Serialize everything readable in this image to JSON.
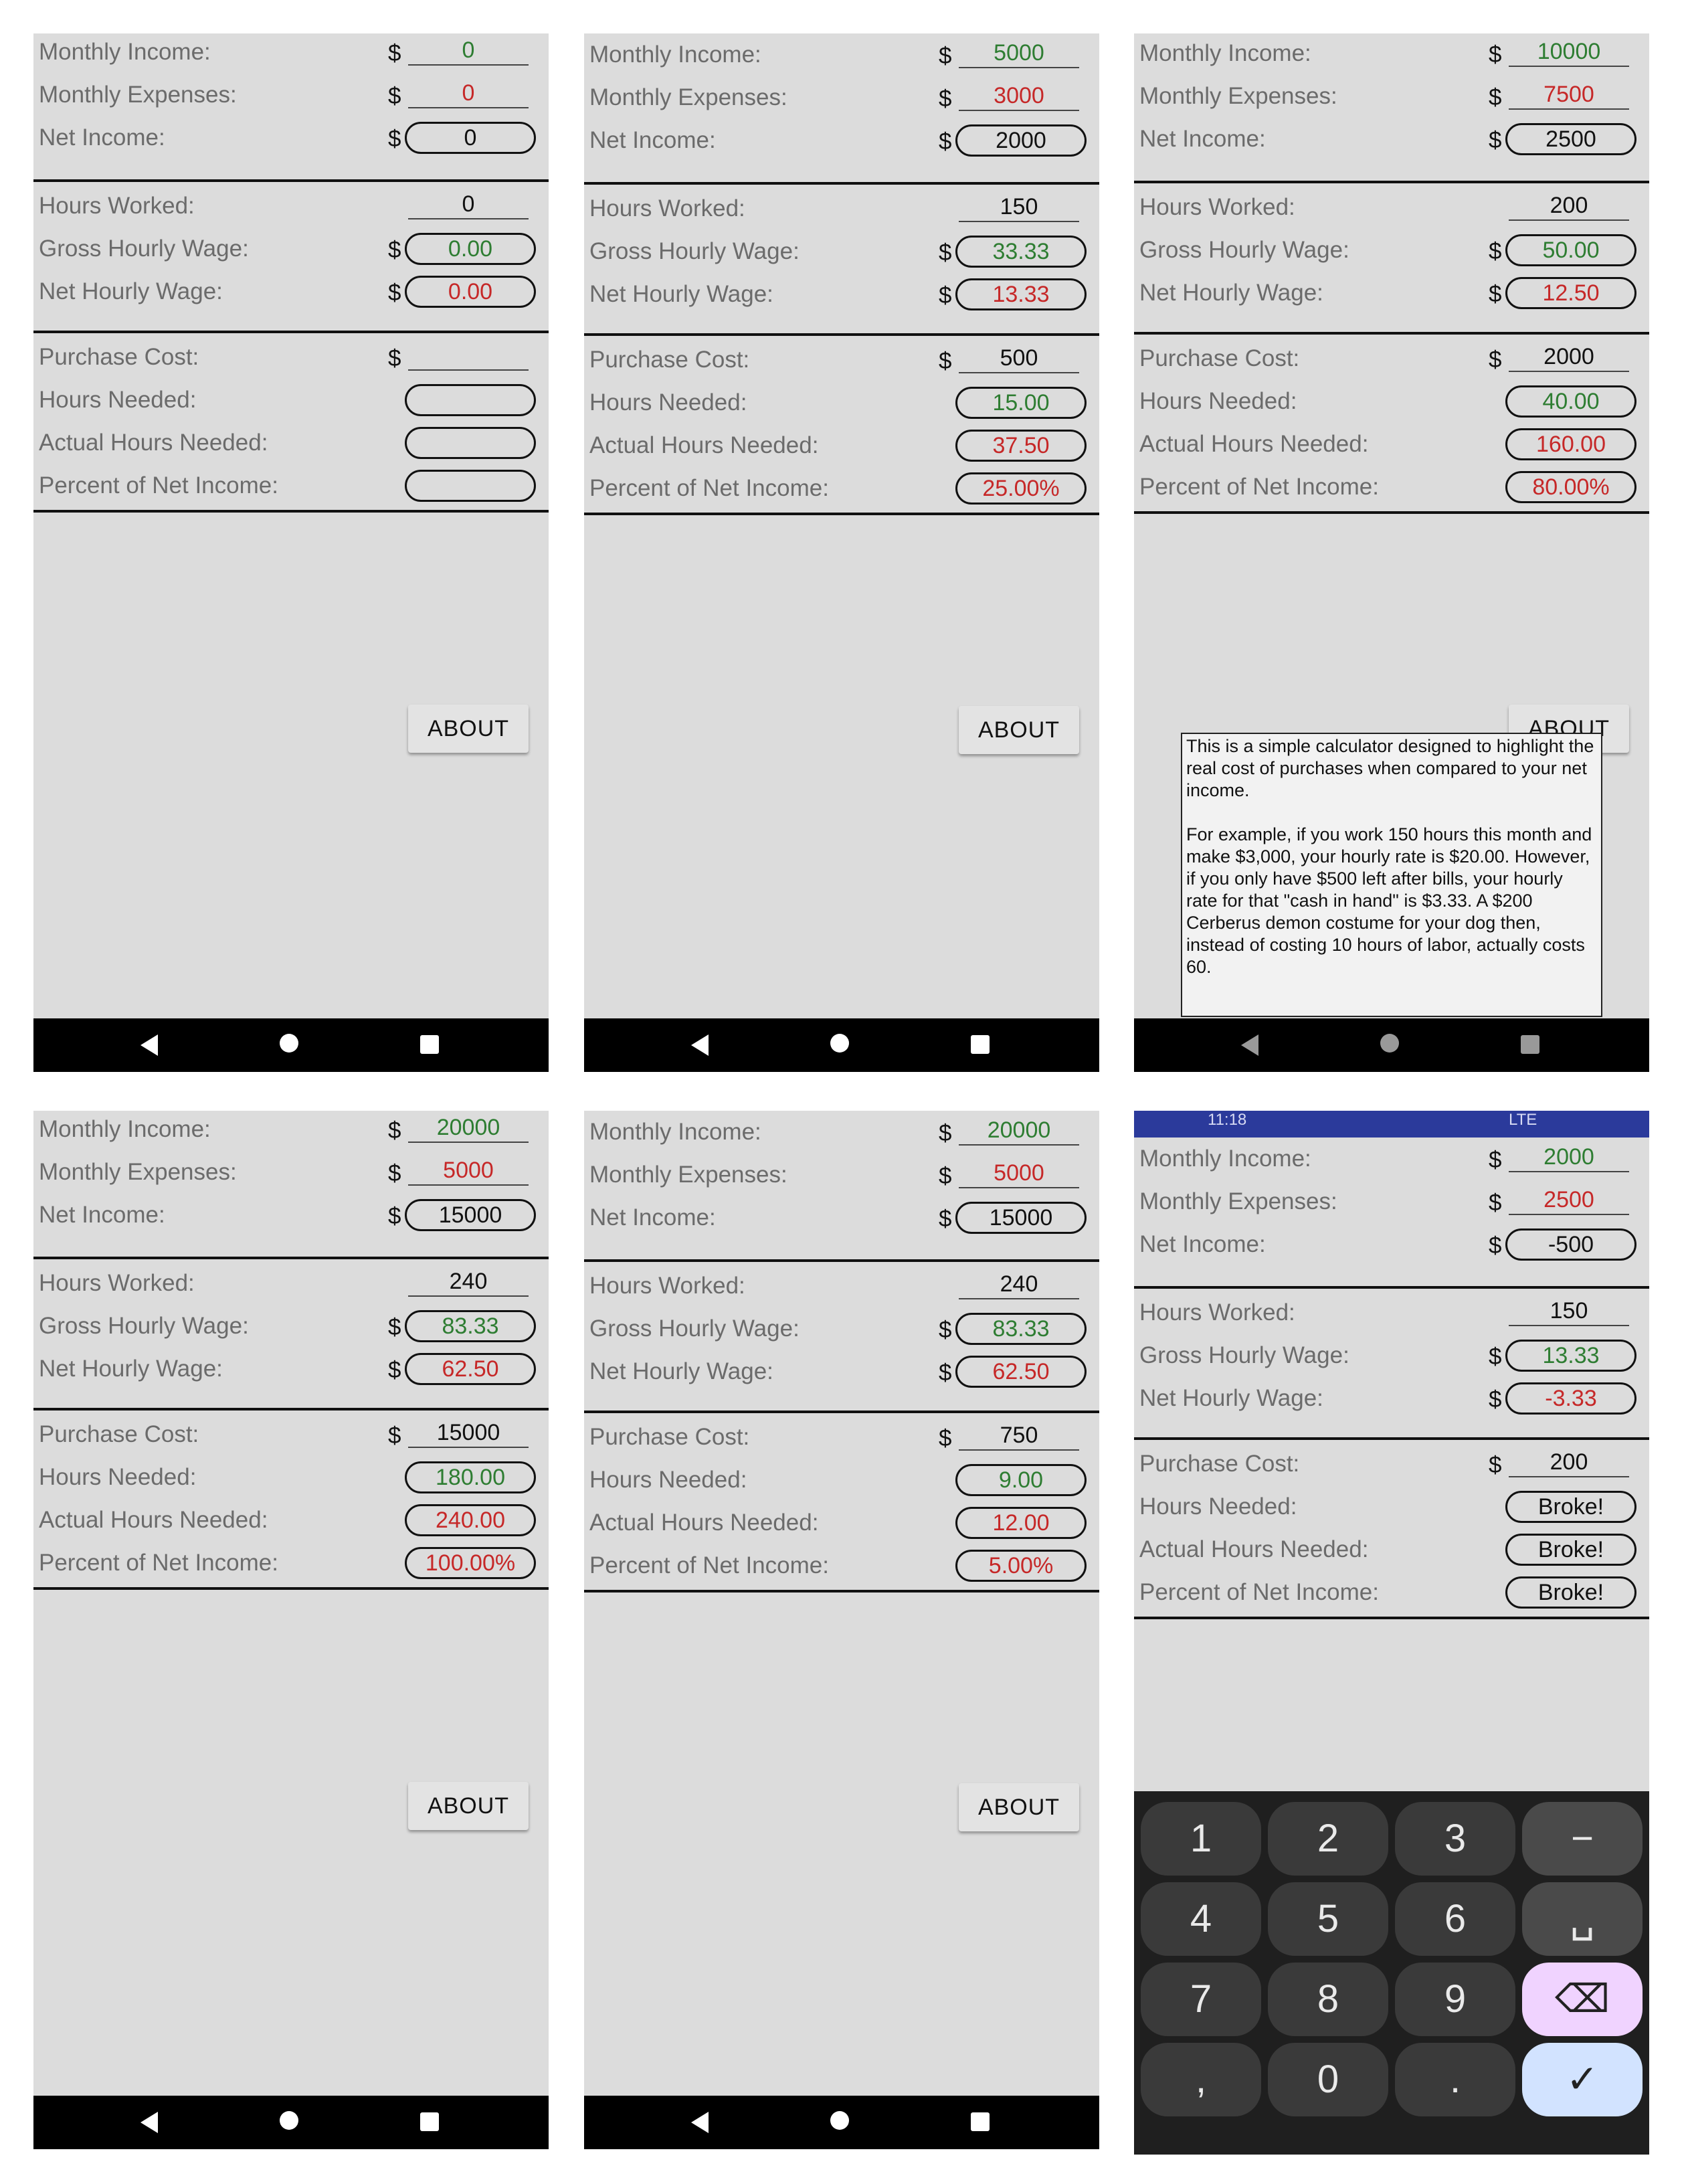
{
  "labels": {
    "monthly_income": "Monthly Income:",
    "monthly_expenses": "Monthly Expenses:",
    "net_income": "Net Income:",
    "hours_worked": "Hours Worked:",
    "gross_hourly_wage": "Gross Hourly Wage:",
    "net_hourly_wage": "Net Hourly Wage:",
    "purchase_cost": "Purchase Cost:",
    "hours_needed": "Hours Needed:",
    "actual_hours_needed": "Actual Hours Needed:",
    "percent_of_net_income": "Percent of Net Income:"
  },
  "currency": "$",
  "about_label": "ABOUT",
  "screens": [
    {
      "income": "0",
      "expenses": "0",
      "net": "0",
      "hours": "0",
      "gross": "0.00",
      "net_wage": "0.00",
      "cost": "",
      "hours_needed": "",
      "actual_hours": "",
      "percent": ""
    },
    {
      "income": "5000",
      "expenses": "3000",
      "net": "2000",
      "hours": "150",
      "gross": "33.33",
      "net_wage": "13.33",
      "cost": "500",
      "hours_needed": "15.00",
      "actual_hours": "37.50",
      "percent": "25.00%"
    },
    {
      "income": "10000",
      "expenses": "7500",
      "net": "2500",
      "hours": "200",
      "gross": "50.00",
      "net_wage": "12.50",
      "cost": "2000",
      "hours_needed": "40.00",
      "actual_hours": "160.00",
      "percent": "80.00%"
    },
    {
      "income": "20000",
      "expenses": "5000",
      "net": "15000",
      "hours": "240",
      "gross": "83.33",
      "net_wage": "62.50",
      "cost": "15000",
      "hours_needed": "180.00",
      "actual_hours": "240.00",
      "percent": "100.00%"
    },
    {
      "income": "20000",
      "expenses": "5000",
      "net": "15000",
      "hours": "240",
      "gross": "83.33",
      "net_wage": "62.50",
      "cost": "750",
      "hours_needed": "9.00",
      "actual_hours": "12.00",
      "percent": "5.00%"
    },
    {
      "income": "2000",
      "expenses": "2500",
      "net": "-500",
      "hours": "150",
      "gross": "13.33",
      "net_wage": "-3.33",
      "cost": "200",
      "hours_needed": "Broke!",
      "actual_hours": "Broke!",
      "percent": "Broke!"
    }
  ],
  "about_dialog": "This is a simple calculator designed to highlight the real cost of purchases when compared to your net income.\n\nFor example, if you work 150 hours this month and make $3,000, your hourly rate is $20.00. However, if you only have $500 left after bills, your hourly rate for that \"cash in hand\" is $3.33. A $200 Cerberus demon costume for your dog then, instead of costing 10 hours of labor, actually costs 60.",
  "status_bar": {
    "time": "11:18",
    "network": "LTE"
  },
  "keyboard": {
    "keys": [
      "1",
      "2",
      "3",
      "−",
      "4",
      "5",
      "6",
      "␣",
      "7",
      "8",
      "9",
      "⌫",
      ",",
      "0",
      ".",
      "✓"
    ]
  },
  "colors": {
    "positive": "#2e7d32",
    "negative": "#c62828",
    "background": "#dcdcdc",
    "status_bar": "#2b3a9b"
  }
}
